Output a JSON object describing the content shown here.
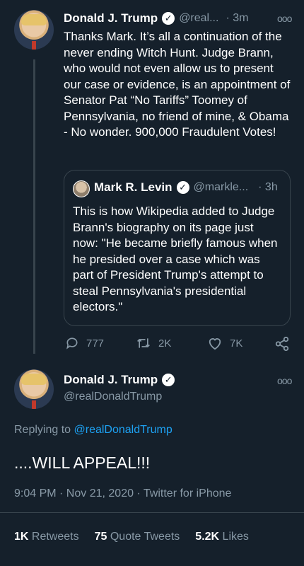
{
  "parent_tweet": {
    "name": "Donald J. Trump",
    "handle": "@real...",
    "time": "· 3m",
    "text": "Thanks Mark. It’s all a continuation of the never ending Witch Hunt. Judge Brann, who would not even allow us to present our case or evidence, is an appointment of Senator Pat “No Tariffs” Toomey of Pennsylvania, no friend of mine, & Obama - No wonder. 900,000 Fraudulent Votes!",
    "quote": {
      "name": "Mark R. Levin",
      "handle": "@markle...",
      "time": "· 3h",
      "text": "This is how Wikipedia added to Judge Brann's biography on its page just now: \"He became briefly famous when he presided over a case which was part of President Trump's attempt to steal Pennsylvania's presidential electors.\""
    },
    "actions": {
      "replies": "777",
      "retweets": "2K",
      "likes": "7K"
    }
  },
  "main_tweet": {
    "name": "Donald J. Trump",
    "handle": "@realDonaldTrump",
    "replying_prefix": "Replying to ",
    "replying_to": "@realDonaldTrump",
    "text": "....WILL APPEAL!!!",
    "meta": "9:04 PM · Nov 21, 2020 · Twitter for iPhone",
    "stats": {
      "retweets_count": "1K",
      "retweets_label": "Retweets",
      "quote_count": "75",
      "quote_label": "Quote Tweets",
      "likes_count": "5.2K",
      "likes_label": "Likes"
    }
  },
  "icons": [
    "verified-badge-icon",
    "more-options-icon",
    "reply-icon",
    "retweet-icon",
    "like-icon",
    "share-icon"
  ],
  "colors": {
    "background": "#15202b",
    "muted": "#8899a6",
    "link": "#1da1f2",
    "border": "#38444d"
  }
}
